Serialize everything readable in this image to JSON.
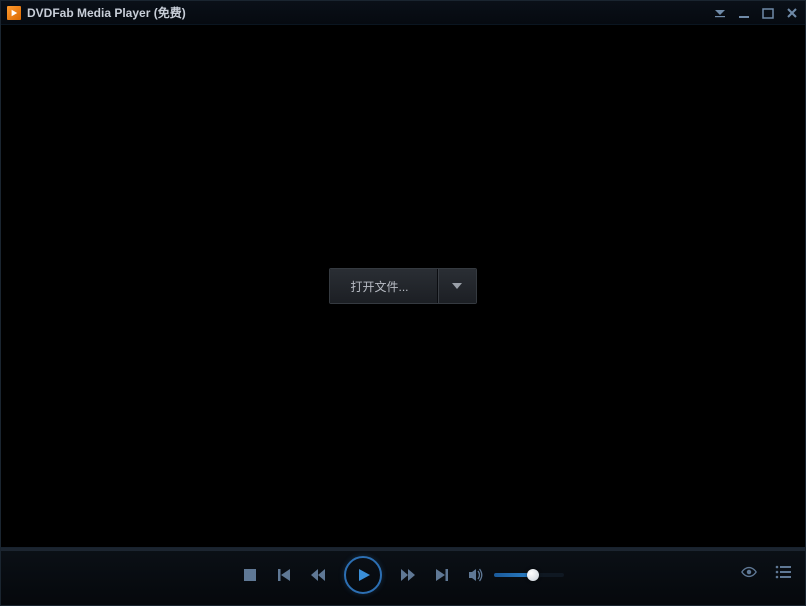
{
  "titlebar": {
    "title": "DVDFab Media Player (免费)"
  },
  "open_file": {
    "label": "打开文件..."
  },
  "volume": {
    "level_percent": 55
  },
  "colors": {
    "accent": "#2c6fb3",
    "icon": "#5f7895",
    "text_muted": "#c8ced8"
  }
}
